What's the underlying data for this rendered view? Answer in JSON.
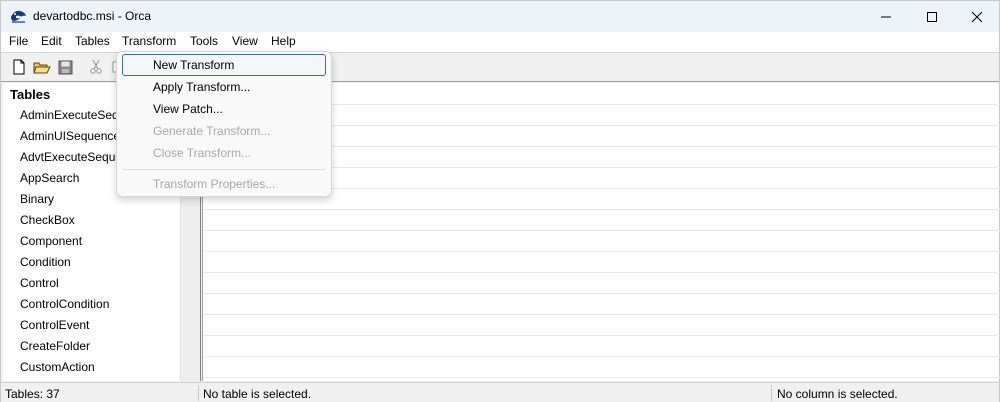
{
  "window": {
    "title": "devartodbc.msi - Orca"
  },
  "menubar": [
    "File",
    "Edit",
    "Tables",
    "Transform",
    "Tools",
    "View",
    "Help"
  ],
  "toolbar": {
    "icons": [
      "new-file-icon",
      "open-folder-icon",
      "save-icon",
      "cut-icon",
      "copy-icon"
    ]
  },
  "tables_panel": {
    "header": "Tables",
    "items": [
      "AdminExecuteSequence",
      "AdminUISequence",
      "AdvtExecuteSequence",
      "AppSearch",
      "Binary",
      "CheckBox",
      "Component",
      "Condition",
      "Control",
      "ControlCondition",
      "ControlEvent",
      "CreateFolder",
      "CustomAction"
    ]
  },
  "transform_menu": {
    "items": [
      {
        "label": "New Transform",
        "enabled": true,
        "selected": true
      },
      {
        "label": "Apply Transform...",
        "enabled": true
      },
      {
        "label": "View Patch...",
        "enabled": true
      },
      {
        "label": "Generate Transform...",
        "enabled": false
      },
      {
        "label": "Close Transform...",
        "enabled": false
      },
      {
        "label": "Transform Properties...",
        "enabled": false
      }
    ]
  },
  "statusbar": {
    "tables_count": "Tables: 37",
    "table_status": "No table is selected.",
    "column_status": "No column is selected."
  },
  "colors": {
    "titlebar": "#eef3f7",
    "menu_selection_border": "#3b6ea8",
    "disabled_text": "#a8a8a8"
  }
}
